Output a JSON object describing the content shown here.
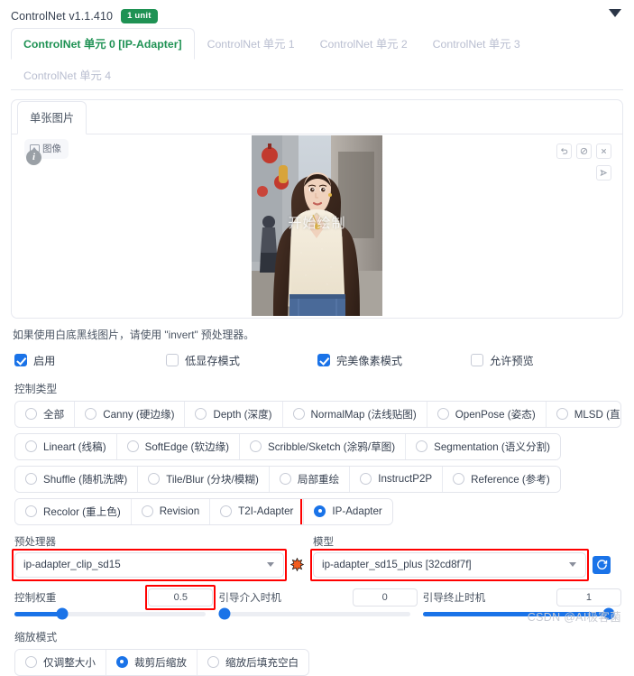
{
  "header": {
    "title": "ControlNet v1.1.410",
    "badge": "1 unit",
    "collapse_icon": "chevron-down-icon"
  },
  "unit_tabs": [
    {
      "label": "ControlNet 单元 0 [IP-Adapter]",
      "active": true
    },
    {
      "label": "ControlNet 单元 1",
      "active": false
    },
    {
      "label": "ControlNet 单元 2",
      "active": false
    },
    {
      "label": "ControlNet 单元 3",
      "active": false
    },
    {
      "label": "ControlNet 单元 4",
      "active": false
    }
  ],
  "panel": {
    "tab_label": "单张图片",
    "image_label": "图像",
    "info_icon": "info-icon",
    "overlay_text": "开始绘制",
    "tools": [
      {
        "name": "undo-icon",
        "glyph": "↺"
      },
      {
        "name": "eraser-icon",
        "glyph": "⌀"
      },
      {
        "name": "close-icon",
        "glyph": "✕"
      }
    ],
    "tool_secondary": {
      "name": "send-to-icon",
      "glyph": "↳"
    }
  },
  "hint": "如果使用白底黑线图片，请使用 \"invert\" 预处理器。",
  "checkboxes": [
    {
      "label": "启用",
      "checked": true
    },
    {
      "label": "低显存模式",
      "checked": false
    },
    {
      "label": "完美像素模式",
      "checked": true
    },
    {
      "label": "允许预览",
      "checked": false
    }
  ],
  "control_type": {
    "label": "控制类型",
    "rows": [
      [
        {
          "label": "全部",
          "selected": false
        },
        {
          "label": "Canny (硬边缘)",
          "selected": false
        },
        {
          "label": "Depth (深度)",
          "selected": false
        },
        {
          "label": "NormalMap (法线贴图)",
          "selected": false
        },
        {
          "label": "OpenPose (姿态)",
          "selected": false
        },
        {
          "label": "MLSD (直线)",
          "selected": false
        }
      ],
      [
        {
          "label": "Lineart (线稿)",
          "selected": false
        },
        {
          "label": "SoftEdge (软边缘)",
          "selected": false
        },
        {
          "label": "Scribble/Sketch (涂鸦/草图)",
          "selected": false
        },
        {
          "label": "Segmentation (语义分割)",
          "selected": false
        }
      ],
      [
        {
          "label": "Shuffle (随机洗牌)",
          "selected": false
        },
        {
          "label": "Tile/Blur (分块/模糊)",
          "selected": false
        },
        {
          "label": "局部重绘",
          "selected": false
        },
        {
          "label": "InstructP2P",
          "selected": false
        },
        {
          "label": "Reference (参考)",
          "selected": false
        }
      ],
      [
        {
          "label": "Recolor (重上色)",
          "selected": false
        },
        {
          "label": "Revision",
          "selected": false
        },
        {
          "label": "T2I-Adapter",
          "selected": false
        },
        {
          "label": "IP-Adapter",
          "selected": true,
          "highlight": true
        }
      ]
    ]
  },
  "preprocessor": {
    "label": "预处理器",
    "value": "ip-adapter_clip_sd15",
    "highlight": true,
    "spark_icon": "explosion-icon"
  },
  "model": {
    "label": "模型",
    "value": "ip-adapter_sd15_plus [32cd8f7f]",
    "highlight": true,
    "refresh_icon": "refresh-icon"
  },
  "sliders": [
    {
      "label": "控制权重",
      "value": "0.5",
      "percent": 25,
      "highlight": true
    },
    {
      "label": "引导介入时机",
      "value": "0",
      "percent": 0,
      "highlight": false
    },
    {
      "label": "引导终止时机",
      "value": "1",
      "percent": 100,
      "highlight": false
    }
  ],
  "resize_mode": {
    "label": "缩放模式",
    "options": [
      {
        "label": "仅调整大小",
        "selected": false
      },
      {
        "label": "裁剪后缩放",
        "selected": true
      },
      {
        "label": "缩放后填充空白",
        "selected": false
      }
    ]
  },
  "watermark": "CSDN @AI极客菌"
}
